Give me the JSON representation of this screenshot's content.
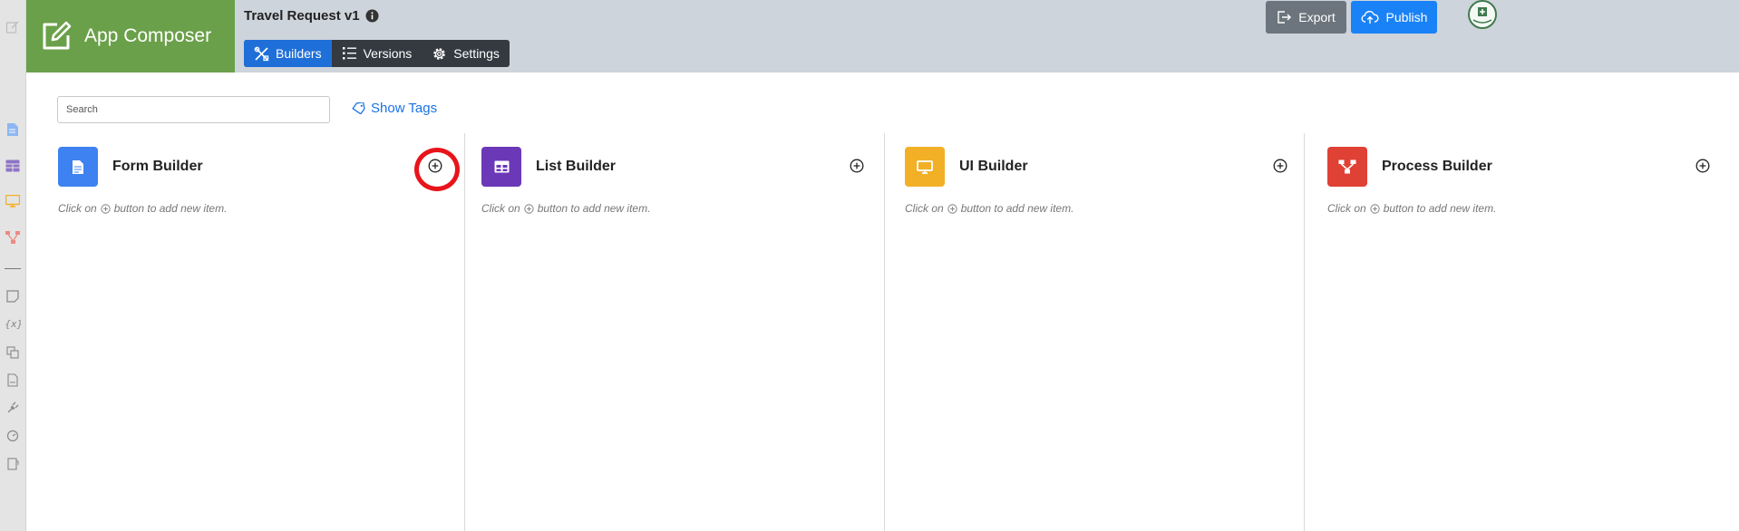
{
  "brand": {
    "title": "App Composer",
    "icon": "edit-square-icon"
  },
  "app": {
    "title": "Travel Request v1",
    "info_icon": "info-circle-icon"
  },
  "tabs": [
    {
      "label": "Builders",
      "icon": "tools-icon",
      "active": true
    },
    {
      "label": "Versions",
      "icon": "list-ordered-icon",
      "active": false
    },
    {
      "label": "Settings",
      "icon": "gear-icon",
      "active": false
    }
  ],
  "actions": {
    "export_label": "Export",
    "publish_label": "Publish"
  },
  "search": {
    "placeholder": "Search",
    "value": ""
  },
  "show_tags_label": "Show Tags",
  "builders": [
    {
      "title": "Form Builder",
      "hint_pre": "Click on",
      "hint_post": "button to add new item.",
      "color": "#3d82f0",
      "icon": "document-icon"
    },
    {
      "title": "List Builder",
      "hint_pre": "Click on",
      "hint_post": "button to add new item.",
      "color": "#6b38b8",
      "icon": "table-icon"
    },
    {
      "title": "UI Builder",
      "hint_pre": "Click on",
      "hint_post": "button to add new item.",
      "color": "#f2b026",
      "icon": "monitor-icon"
    },
    {
      "title": "Process Builder",
      "hint_pre": "Click on",
      "hint_post": "button to add new item.",
      "color": "#e04135",
      "icon": "process-flow-icon"
    }
  ],
  "colors": {
    "brand_green": "#6ba04a",
    "topbar": "#ced4db",
    "primary": "#1a82f7",
    "link": "#1a73e8",
    "highlight_ring": "#e8141a"
  }
}
